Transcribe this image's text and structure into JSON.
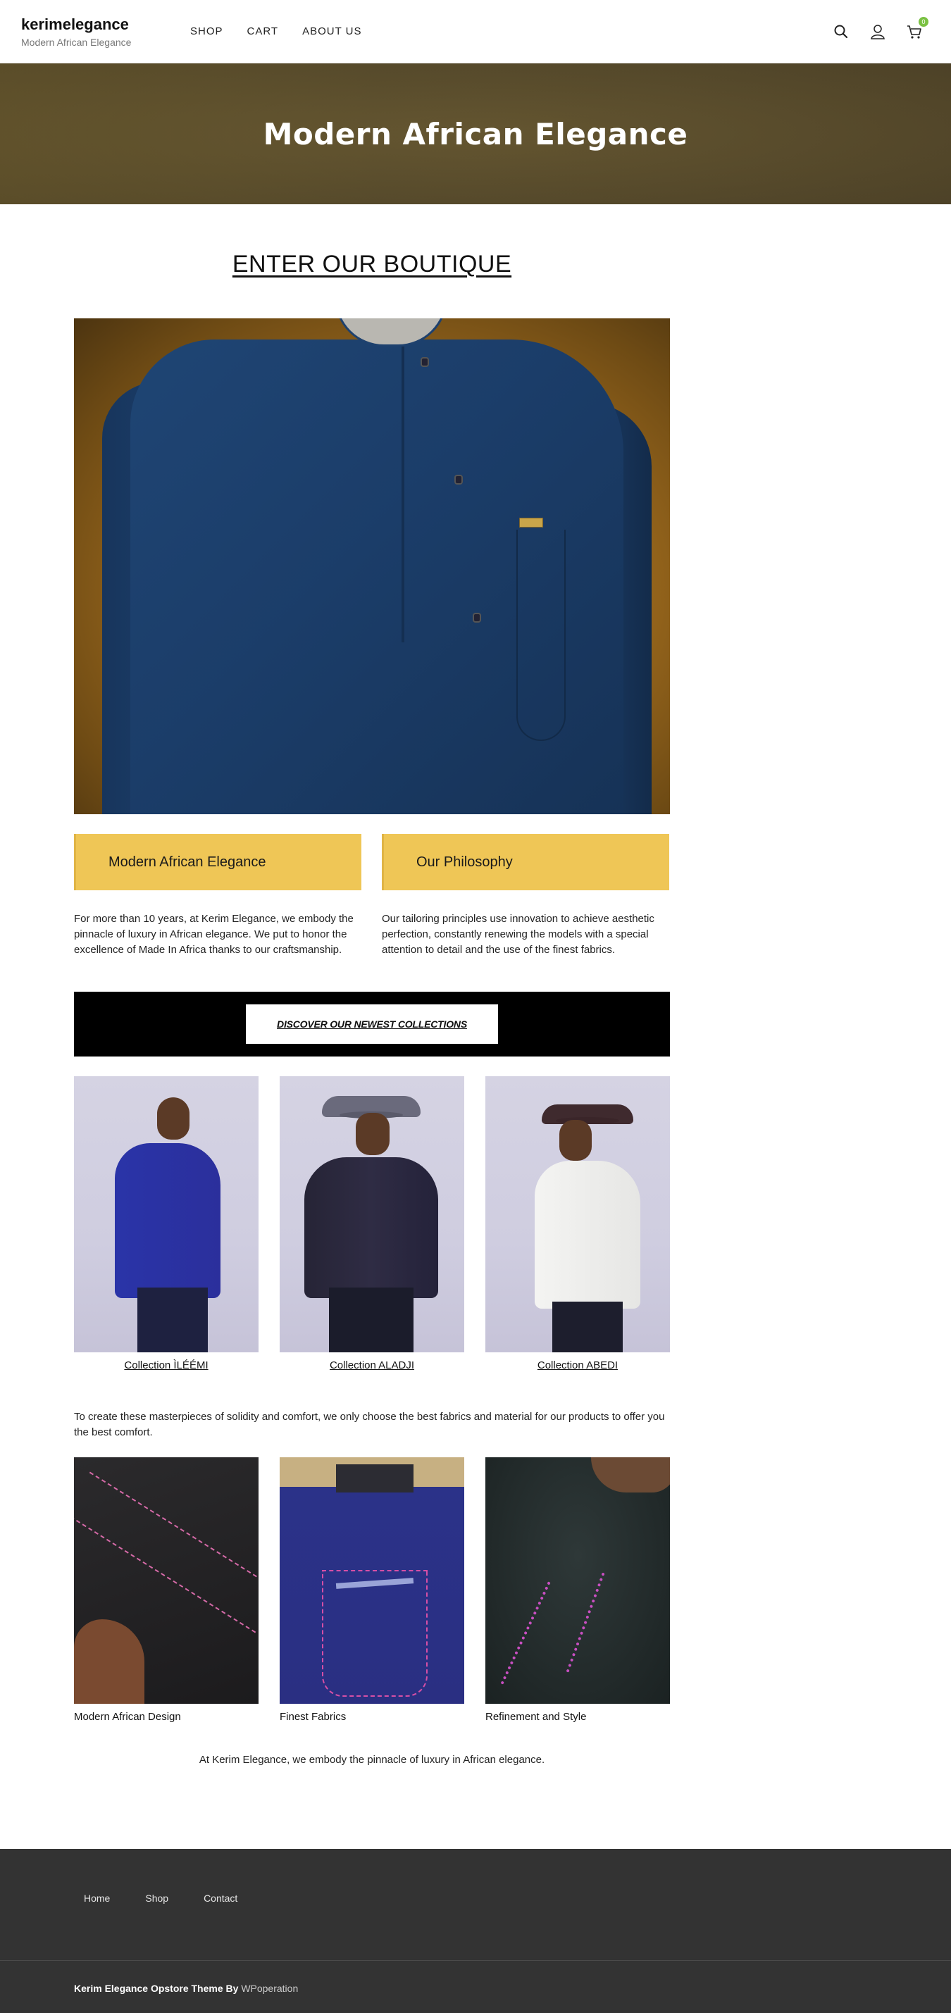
{
  "header": {
    "site_title": "kerimelegance",
    "tagline": "Modern African Elegance",
    "nav": [
      "SHOP",
      "CART",
      "ABOUT US"
    ],
    "cart_count": "0",
    "icons": [
      "search-icon",
      "user-icon",
      "cart-icon"
    ]
  },
  "hero": {
    "title": "Modern African Elegance"
  },
  "main": {
    "boutique_link": "ENTER OUR BOUTIQUE",
    "columns": [
      {
        "heading": "Modern African Elegance",
        "text": "For more than 10 years, at Kerim Elegance, we embody the pinnacle of luxury in African elegance. We put to honor the excellence of Made In Africa thanks to our craftsmanship."
      },
      {
        "heading": "Our Philosophy",
        "text": "Our tailoring principles use innovation to achieve aesthetic perfection, constantly renewing the models with a special attention to detail and the use of the finest fabrics."
      }
    ],
    "discover_button": "DISCOVER OUR NEWEST COLLECTIONS",
    "collections": [
      "Collection ÌLÉÉMI",
      "Collection ALADJI",
      "Collection ABEDI"
    ],
    "fabric_text": "To create these masterpieces of solidity and comfort, we only choose the best fabrics and material for our products to offer you the best comfort.",
    "details": [
      "Modern African Design",
      "Finest Fabrics",
      "Refinement and Style"
    ],
    "closing": "At Kerim Elegance, we embody the pinnacle of luxury in African elegance."
  },
  "footer": {
    "nav": [
      "Home",
      "Shop",
      "Contact"
    ],
    "credit_prefix": "Kerim Elegance Opstore Theme By",
    "credit_link": "WPoperation"
  },
  "colors": {
    "accent_yellow": "#efc656",
    "cart_badge": "#7ac142",
    "footer_bg": "#333333",
    "hero_bg": "#5e5130"
  }
}
